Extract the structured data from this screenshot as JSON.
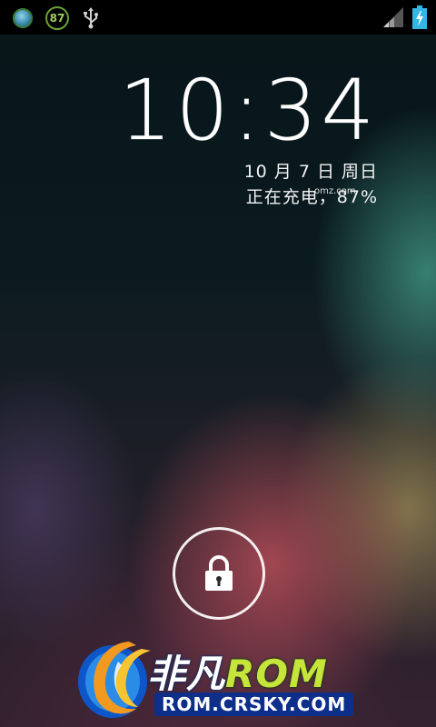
{
  "status_bar": {
    "notification_icons": [
      "app-icon",
      "battery-percent-badge",
      "usb-icon"
    ],
    "battery_badge_text": "87",
    "right_icons": [
      "signal-icon",
      "battery-charging-icon"
    ]
  },
  "lockscreen": {
    "time": "10:34",
    "date": "10 月 7 日 周日",
    "charging_status": "正在充电，87%",
    "unlock_icon": "lock-icon"
  },
  "watermark": {
    "overlay_text": "omz.com"
  },
  "branding": {
    "title_cn": "非凡",
    "title_rom": "ROM",
    "url": "ROM.CRSKY.COM"
  },
  "colors": {
    "status_bar_bg": "#000000",
    "text": "#ffffff",
    "brand_green": "#c7e43a",
    "brand_blue": "#0d2f8a"
  }
}
